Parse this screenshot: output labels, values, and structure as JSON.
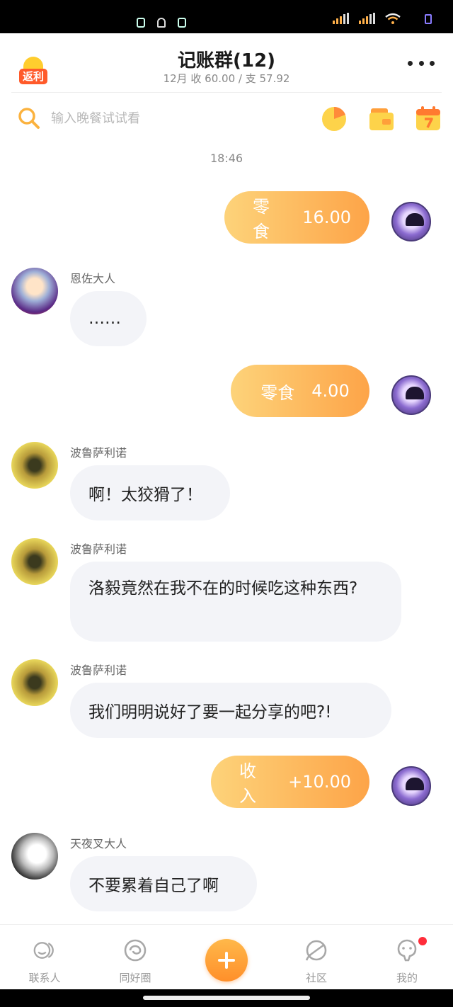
{
  "header": {
    "promo_badge": "返利",
    "title": "记账群(12)",
    "subtitle": "12月  收  60.00  /  支  57.92"
  },
  "search": {
    "placeholder": "输入晚餐试试看"
  },
  "timestamp": "18:46",
  "messages": [
    {
      "direction": "out",
      "category": "零食",
      "amount": "16.00"
    },
    {
      "direction": "in",
      "sender": "恩佐大人",
      "text": "……"
    },
    {
      "direction": "out",
      "category": "零食",
      "amount": "4.00"
    },
    {
      "direction": "in",
      "sender": "波鲁萨利诺",
      "text": "啊！太狡猾了！"
    },
    {
      "direction": "in",
      "sender": "波鲁萨利诺",
      "text": "洛毅竟然在我不在的时候吃这种东西?"
    },
    {
      "direction": "in",
      "sender": "波鲁萨利诺",
      "text": "我们明明说好了要一起分享的吧?!"
    },
    {
      "direction": "out",
      "category": "收入",
      "amount": "+10.00"
    },
    {
      "direction": "in",
      "sender": "天夜叉大人",
      "text": "不要累着自己了啊"
    }
  ],
  "bottom_nav": [
    {
      "label": "联系人",
      "icon": "contacts-icon"
    },
    {
      "label": "同好圈",
      "icon": "circle-icon"
    },
    {
      "label": "",
      "icon": "add-icon"
    },
    {
      "label": "社区",
      "icon": "planet-icon"
    },
    {
      "label": "我的",
      "icon": "profile-icon",
      "badge": true
    }
  ],
  "colors": {
    "accent_orange": "#fda448",
    "bubble_gradient_start": "#fdd37a",
    "incoming_bubble": "#f3f4f8",
    "badge_red": "#ff2d3a"
  }
}
